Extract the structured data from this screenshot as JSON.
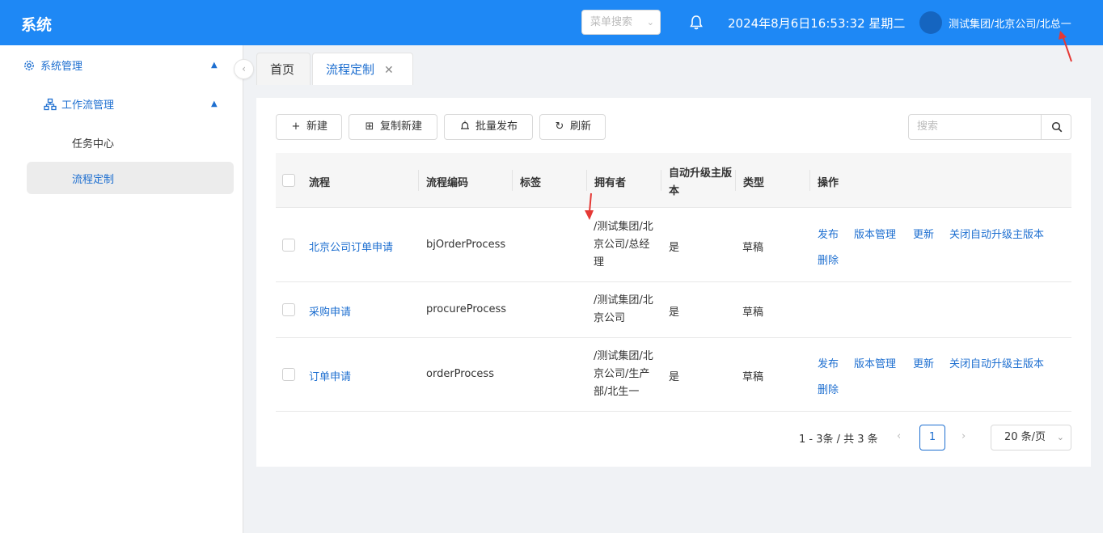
{
  "app": {
    "title": "系统"
  },
  "header": {
    "menu_search_placeholder": "菜单搜索",
    "datetime": "2024年8月6日16:53:32 星期二",
    "user": "测试集团/北京公司/北总一"
  },
  "sidebar": {
    "system_mgmt": "系统管理",
    "workflow_mgmt": "工作流管理",
    "task_center": "任务中心",
    "flow_custom": "流程定制"
  },
  "tabs": [
    {
      "label": "首页"
    },
    {
      "label": "流程定制"
    }
  ],
  "toolbar": {
    "new": "新建",
    "copy_new": "复制新建",
    "batch_publish": "批量发布",
    "refresh": "刷新",
    "search_placeholder": "搜索"
  },
  "table": {
    "columns": [
      "流程",
      "流程编码",
      "标签",
      "拥有者",
      "自动升级主版本",
      "类型",
      "操作"
    ],
    "rows": [
      {
        "name": "北京公司订单申请",
        "code": "bjOrderProcess",
        "tag": "",
        "owner": "/测试集团/北京公司/总经理",
        "auto_upgrade": "是",
        "type": "草稿",
        "actions": [
          "发布",
          "版本管理",
          "更新",
          "关闭自动升级主版本",
          "删除"
        ]
      },
      {
        "name": "采购申请",
        "code": "procureProcess",
        "tag": "",
        "owner": "/测试集团/北京公司",
        "auto_upgrade": "是",
        "type": "草稿",
        "actions": []
      },
      {
        "name": "订单申请",
        "code": "orderProcess",
        "tag": "",
        "owner": "/测试集团/北京公司/生产部/北生一",
        "auto_upgrade": "是",
        "type": "草稿",
        "actions": [
          "发布",
          "版本管理",
          "更新",
          "关闭自动升级主版本",
          "删除"
        ]
      }
    ]
  },
  "pagination": {
    "summary": "1 - 3条 / 共 3 条",
    "current_page": "1",
    "page_size": "20 条/页"
  },
  "colors": {
    "header_bg": "#1e88f5",
    "link": "#1e6fd0",
    "marker": "#e53935"
  }
}
